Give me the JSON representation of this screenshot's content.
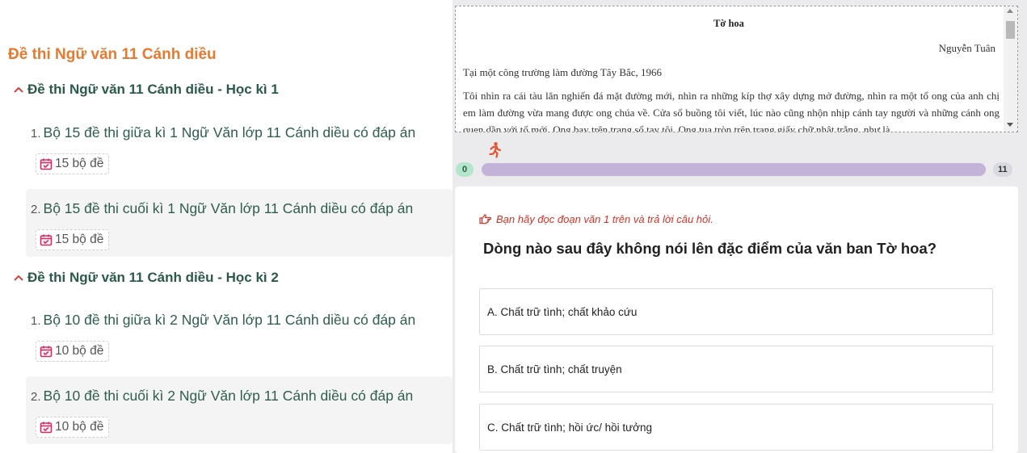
{
  "left": {
    "main_title": "Đề thi Ngữ văn 11 Cánh diều",
    "sections": [
      {
        "label": "Đề thi Ngữ văn 11 Cánh diều - Học kì 1",
        "items": [
          {
            "num": "1.",
            "title": "Bộ 15 đề thi giữa kì 1 Ngữ Văn lớp 11 Cánh diều có đáp án",
            "badge": "15 bộ đề"
          },
          {
            "num": "2.",
            "title": "Bộ 15 đề thi cuối kì 1 Ngữ Văn lớp 11 Cánh diều có đáp án",
            "badge": "15 bộ đề"
          }
        ]
      },
      {
        "label": "Đề thi Ngữ văn 11 Cánh diều - Học kì 2",
        "items": [
          {
            "num": "1.",
            "title": "Bộ 10 đề thi giữa kì 2 Ngữ Văn lớp 11 Cánh diều có đáp án",
            "badge": "10 bộ đề"
          },
          {
            "num": "2.",
            "title": "Bộ 10 đề thi cuối kì 2 Ngữ Văn lớp 11 Cánh diều có đáp án",
            "badge": "10 bộ đề"
          }
        ]
      }
    ]
  },
  "passage": {
    "title": "Tờ hoa",
    "author": "Nguyễn Tuân",
    "line1": "Tại một công trường làm đường Tây Bắc, 1966",
    "body": "Tôi nhìn ra cái tàu lăn nghiến đá mặt đường mới, nhìn ra những kíp thợ xây dựng mở đường, nhìn ra một tổ ong của anh chị em làm đường vừa mang được ong chúa về. Cửa sổ buồng tôi viết, lúc nào cũng nhộn nhịp cánh tay người và những cánh ong quen dần với tổ mới. Ong bay trên trang sổ tay tôi. Ong tụa tròn trên trang giấy chữ nhật trắng, như là"
  },
  "progress": {
    "start": "0",
    "end": "11",
    "current": 11,
    "total": 11
  },
  "quiz": {
    "hint": "Bạn hãy đọc đoạn văn 1 trên và trả lời câu hỏi.",
    "question": "Dòng nào sau đây không nói lên đặc điểm của văn ban Tờ hoa?",
    "options": [
      "A. Chất trữ tình; chất khảo cứu",
      "B. Chất trữ tình; chất truyện",
      "C. Chất trữ tình; hồi ức/ hồi tưởng"
    ]
  },
  "colors": {
    "main_title": "#e8792e",
    "section_text": "#2b5a4a",
    "badge_icon": "#e0245e",
    "hint": "#d93025",
    "runner": "#e8532e",
    "progress_track": "#c3b3d8",
    "start_pill": "#b3e6cc"
  },
  "icons": {
    "section_toggle": "chevron-up-icon",
    "badge": "calendar-check-icon",
    "runner": "running-person-icon",
    "hint": "pointing-hand-icon"
  }
}
